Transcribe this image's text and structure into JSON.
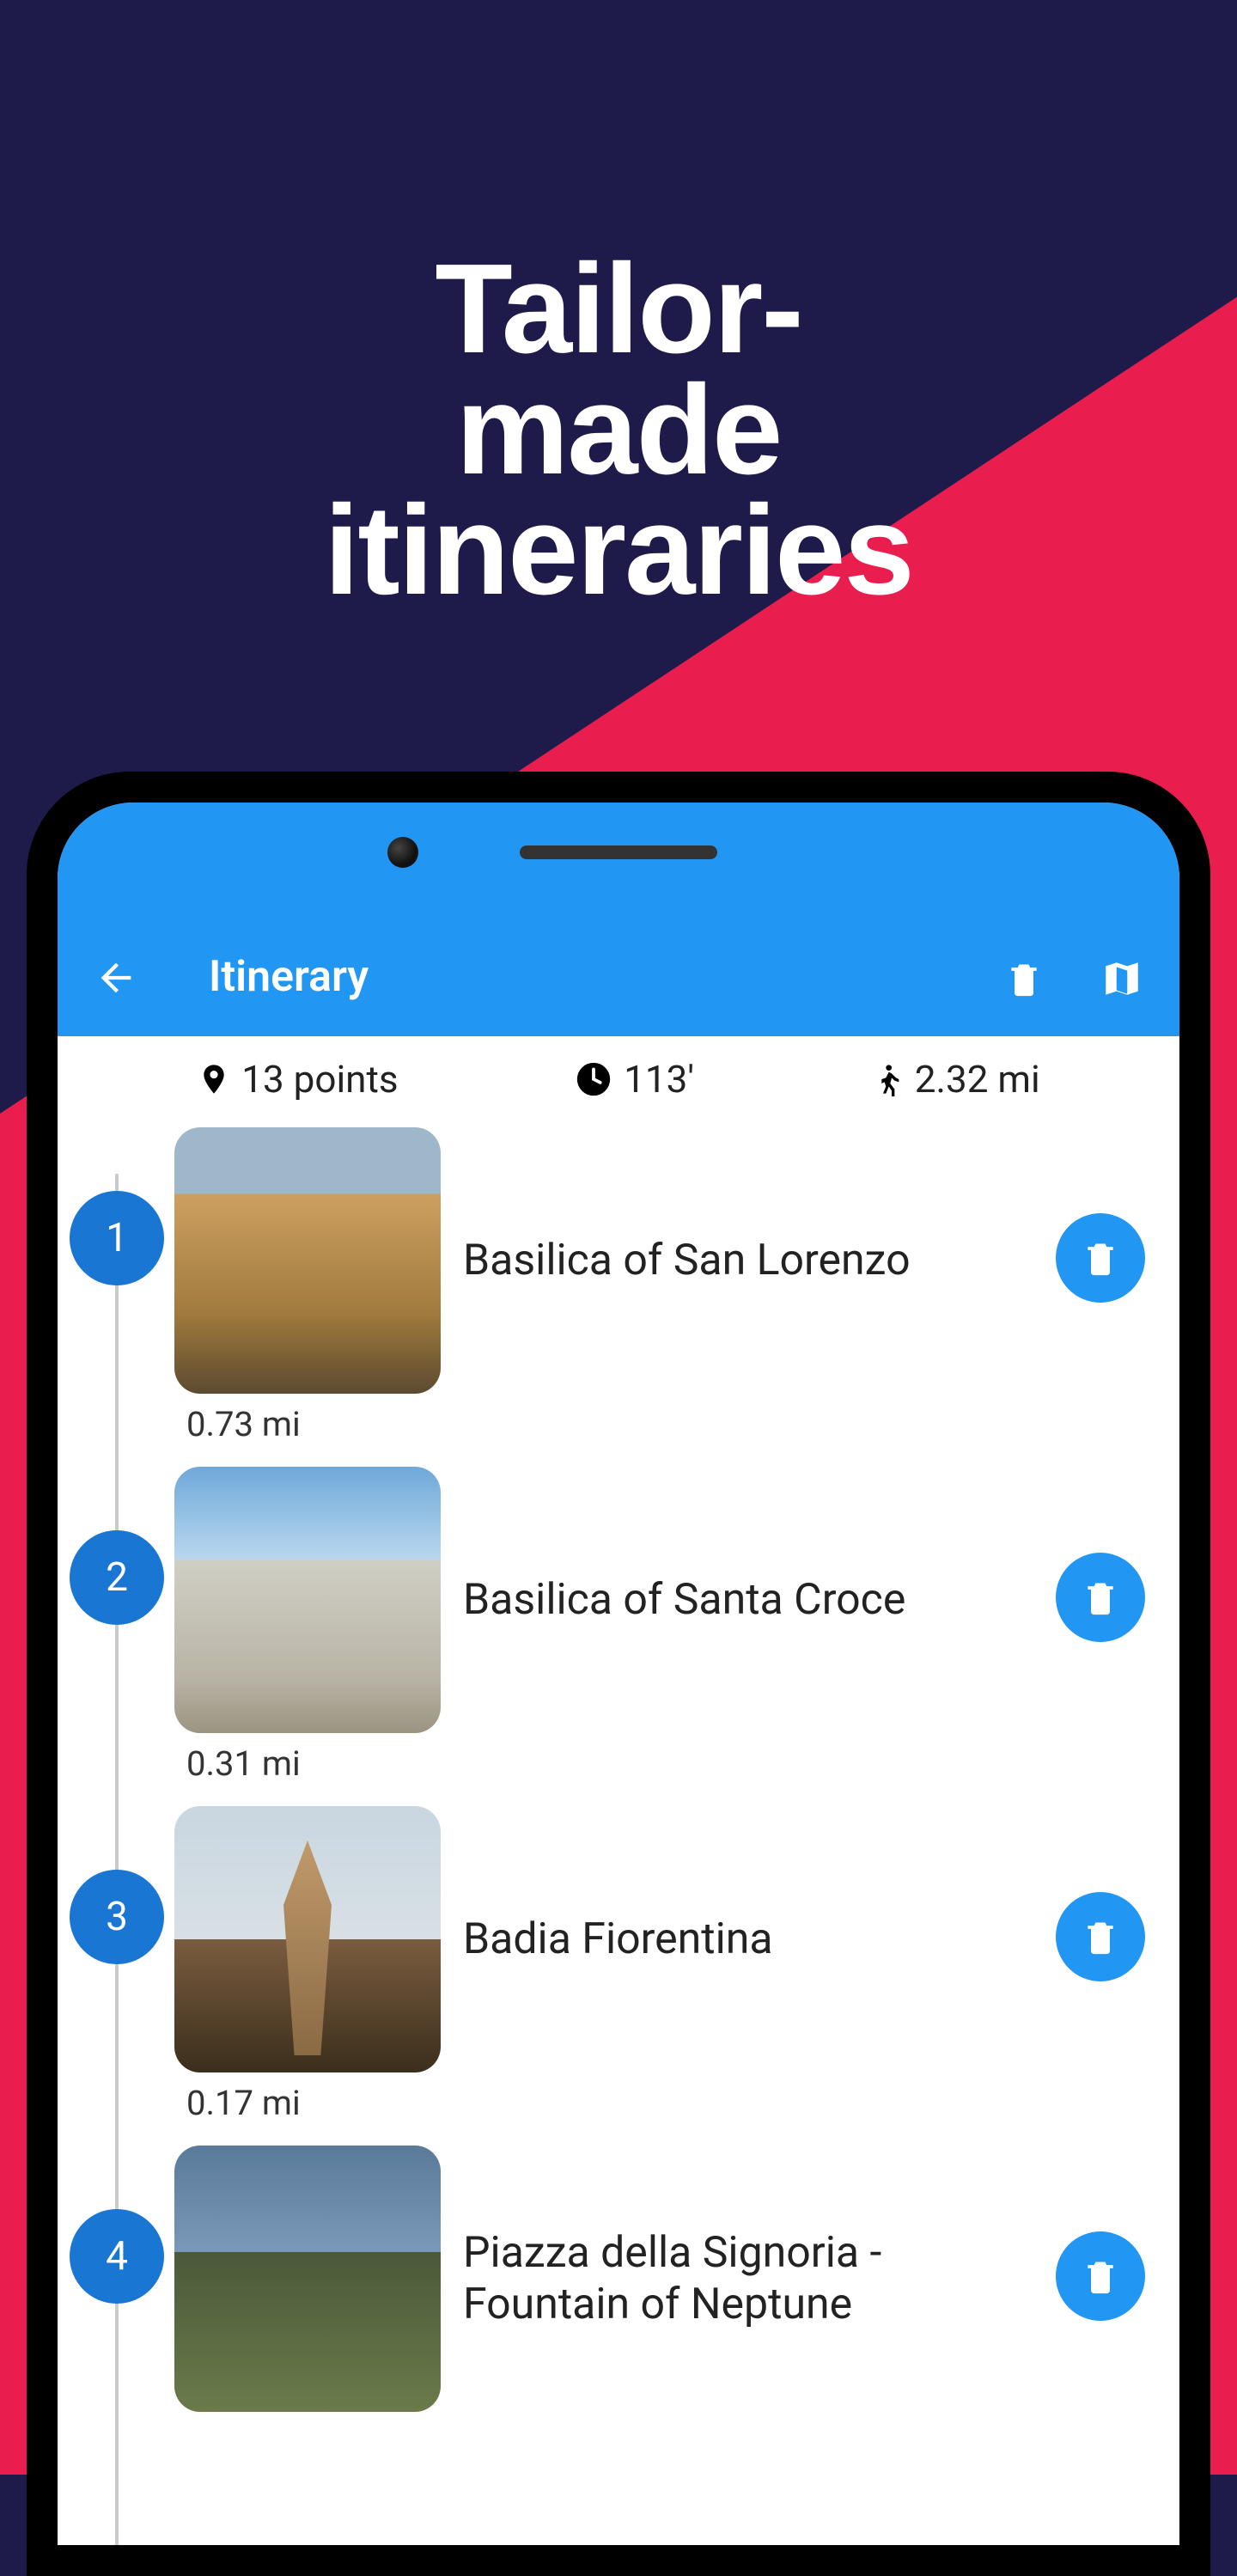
{
  "headline": "Tailor-made\nitineraries",
  "topbar": {
    "title": "Itinerary"
  },
  "stats": {
    "points_label": "13 points",
    "duration_label": "113'",
    "distance_label": "2.32 mi"
  },
  "items": [
    {
      "num": "1",
      "name": "Basilica of San Lorenzo",
      "dist": "0.73 mi"
    },
    {
      "num": "2",
      "name": "Basilica of Santa Croce",
      "dist": "0.31 mi"
    },
    {
      "num": "3",
      "name": "Badia Fiorentina",
      "dist": "0.17 mi"
    },
    {
      "num": "4",
      "name": "Piazza della Signoria - Fountain of Neptune",
      "dist": ""
    }
  ]
}
